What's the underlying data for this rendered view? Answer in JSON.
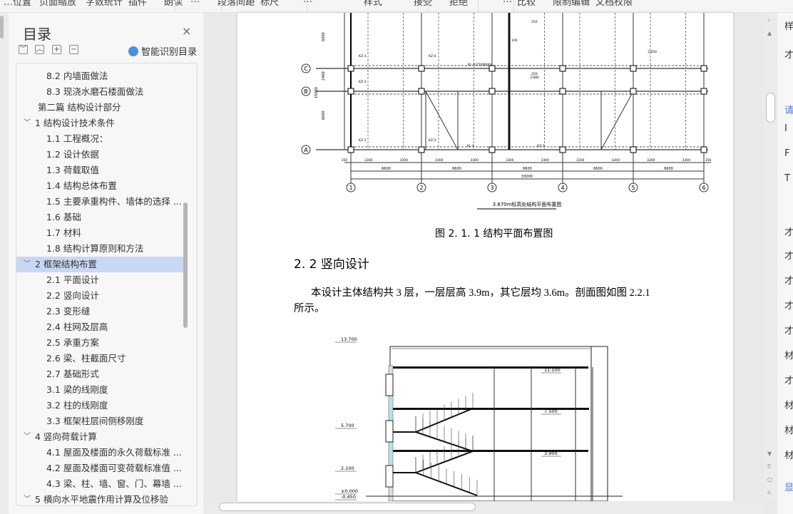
{
  "toolbar": {
    "items": [
      "…位置",
      "页面缩放",
      "字数统计",
      "插件",
      "朗读",
      "…",
      "段落间距",
      "…",
      "标尺",
      "…",
      "样式",
      "接受",
      "拒绝",
      "…",
      "比较",
      "限制编辑",
      "文档权限"
    ]
  },
  "sidebar": {
    "title": "目录",
    "close": "×",
    "buttons": [
      "﹀",
      "︿",
      "+",
      "−"
    ],
    "smart_toc": "智能识别目录",
    "items": [
      {
        "label": "8.2 内墙面做法",
        "level": 2
      },
      {
        "label": "8.3 现浇水磨石楼面做法",
        "level": 2
      },
      {
        "label": "第二篇  结构设计部分",
        "level": 0
      },
      {
        "label": "1  结构设计技术条件",
        "level": 1,
        "expanded": true
      },
      {
        "label": "1.1  工程概况：",
        "level": 2
      },
      {
        "label": "1.2  设计依据",
        "level": 2
      },
      {
        "label": "1.3  荷载取值",
        "level": 2
      },
      {
        "label": "1.4  结构总体布置",
        "level": 2
      },
      {
        "label": "1.5  主要承重构件、墙体的选择 ...",
        "level": 2
      },
      {
        "label": "1.6  基础",
        "level": 2
      },
      {
        "label": "1.7  材料",
        "level": 2
      },
      {
        "label": "1.8  结构计算原则和方法",
        "level": 2
      },
      {
        "label": "2  框架结构布置",
        "level": 1,
        "expanded": true,
        "selected": true
      },
      {
        "label": "2.1  平面设计",
        "level": 2
      },
      {
        "label": "2.2  竖向设计",
        "level": 2
      },
      {
        "label": "2.3  变形缝",
        "level": 2
      },
      {
        "label": "2.4  柱网及层高",
        "level": 2
      },
      {
        "label": "2.5  承重方案",
        "level": 2
      },
      {
        "label": "2.6  梁、柱截面尺寸",
        "level": 2
      },
      {
        "label": "2.7  基础形式",
        "level": 2
      },
      {
        "label": "3.1  梁的线刚度",
        "level": 2
      },
      {
        "label": "3.2  柱的线刚度",
        "level": 2
      },
      {
        "label": "3.3  框架柱层间侧移刚度",
        "level": 2
      },
      {
        "label": "4  竖向荷载计算",
        "level": 1,
        "expanded": true
      },
      {
        "label": "4.1  屋面及楼面的永久荷载标准 ...",
        "level": 2
      },
      {
        "label": "4.2  屋面及楼面可变荷载标准值 ...",
        "level": 2
      },
      {
        "label": "4.3  梁、柱、墙、窗、门、幕墙 ...",
        "level": 2
      },
      {
        "label": "5  横向水平地震作用计算及位移验",
        "level": 1,
        "expanded": true
      }
    ]
  },
  "document": {
    "plan": {
      "axes_rows": [
        "C",
        "B",
        "A"
      ],
      "axes_cols": [
        "1",
        "2",
        "3",
        "4",
        "5",
        "6"
      ],
      "dims_small": [
        "350",
        "3300",
        "3300",
        "3300",
        "3300",
        "3300",
        "3300",
        "3300",
        "3300",
        "3300",
        "3300",
        "350"
      ],
      "dims_bay": [
        "6600",
        "6600",
        "6600",
        "6600",
        "6600"
      ],
      "dim_total": "33000",
      "dims_vertical": [
        "6000",
        "2400",
        "6000",
        "15000"
      ],
      "labels": [
        "KZ-3",
        "KZ-4",
        "KL-3(250X600)",
        "KZ-3",
        "KZ-1",
        "KZ-2",
        "KL-1",
        "KZ-1",
        "250",
        "250",
        "100",
        "3.650",
        "3.680"
      ],
      "drawing_title": "3.870m标高处结构平面布置图"
    },
    "figure_caption": "图 2. 1. 1  结构平面布置图",
    "heading": "2. 2  竖向设计",
    "paragraph": "本设计主体结构共 3 层，一层层高 3.9m，其它层均 3.6m。剖面图如图 2.2.1",
    "paragraph_cont": "所示。",
    "section": {
      "elevations": [
        "13.700",
        "11.100",
        "7.500",
        "5.700",
        "3.900",
        "2.100",
        "±0.000",
        "-0.450"
      ]
    }
  },
  "right_panel": {
    "texts": [
      "样",
      "才",
      "请",
      "I",
      "F",
      "T",
      "才",
      "才",
      "才",
      "才",
      "才",
      "材",
      "才",
      "材",
      "材",
      "材",
      "显"
    ]
  },
  "colors": {
    "selected": "#c9d8f2",
    "accent": "#4a90e2",
    "glass": "#a8e8f0"
  }
}
